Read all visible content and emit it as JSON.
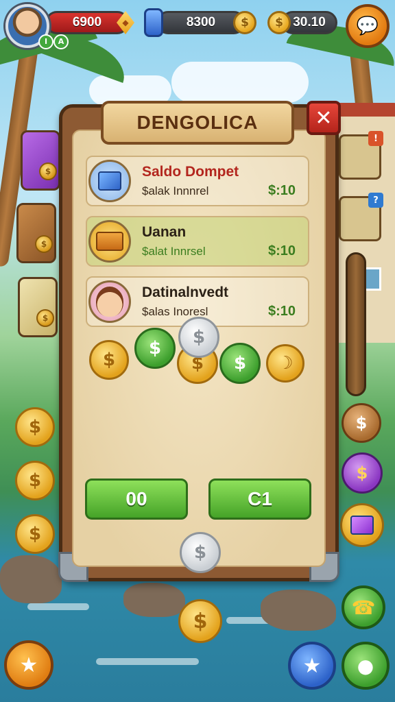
{
  "hud": {
    "health_value": "6900",
    "gem_value": "8300",
    "coin_value": "30.10",
    "level_badge": "A"
  },
  "panel": {
    "title": "DENGOLICA",
    "close_label": "✕",
    "rows": [
      {
        "name": "Saldo Dompet",
        "sub": "$alak Innnrel",
        "price": "$:10",
        "name_color": "#b3261e",
        "price_color": "#3b7d1f",
        "icon": "blue-book-icon"
      },
      {
        "name": "Uanan",
        "sub": "$alat Innrsel",
        "price": "$:10",
        "name_color": "#2b2116",
        "price_color": "#3b7d1f",
        "icon": "orange-brick-icon"
      },
      {
        "name": "Datinalnvedt",
        "sub": "$alas Inoresl",
        "price": "$:10",
        "name_color": "#2b2116",
        "price_color": "#3b7d1f",
        "icon": "girl-avatar-icon"
      }
    ],
    "buttons": {
      "left_label": "00",
      "right_label": "C1"
    }
  },
  "colors": {
    "panel_wood": "#8d5a33",
    "parchment": "#f4e6c6",
    "accent_green": "#45a328",
    "health_red": "#d9332e"
  },
  "coin_symbol": "$"
}
